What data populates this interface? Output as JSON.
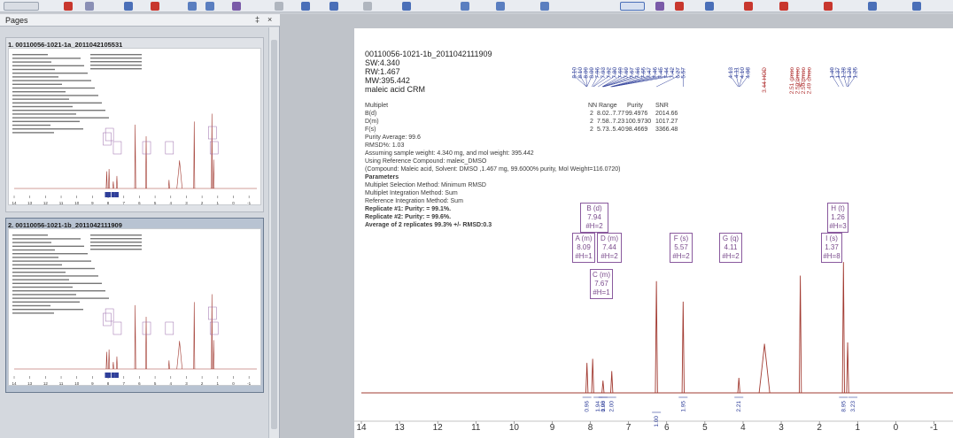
{
  "pages_panel": {
    "title": "Pages",
    "pin_label": "‡",
    "close_label": "×",
    "items": [
      {
        "index": "1.",
        "name": "00110056-1021-1a_2011042105531"
      },
      {
        "index": "2.",
        "name": "00110056-1021-1b_2011042111909"
      }
    ]
  },
  "report": {
    "sample_name": "00110056-1021-1b_2011042111909",
    "sw": "SW:4.340",
    "rw": "RW:1.467",
    "mw": "MW:395.442",
    "compound": "maleic acid CRM",
    "multiplet_label": "Multiplet",
    "table_header": [
      "NN",
      "Range",
      "Purity",
      "SNR"
    ],
    "table_rows": [
      {
        "name": "B(d)",
        "nn": "2",
        "range": "8.02..7.77",
        "purity": "99.4976",
        "snr": "2014.66"
      },
      {
        "name": "D(m)",
        "nn": "2",
        "range": "7.58..7.23",
        "purity": "100.9730",
        "snr": "1017.27"
      },
      {
        "name": "F(s)",
        "nn": "2",
        "range": "5.73..5.40",
        "purity": "98.4669",
        "snr": "3366.48"
      }
    ],
    "purity_average": "Purity Average: 99.6",
    "rmsd": "RMSD%: 1.03",
    "assuming": "Assuming sample weight: 4.340 mg, and mol weight: 395.442",
    "using_ref": "Using Reference Compound: maleic_DMSO",
    "compound_line": "(Compound: Maleic acid, Solvent: DMSO ,1.467 mg, 99.6000% purity, Mol Weight=116.0720)",
    "parameters_label": "Parameters",
    "param_1": "Multiplet Selection Method: Minimum RMSD",
    "param_2": "Multiplet Integration Method: Sum",
    "param_3": "Reference Integration Method: Sum",
    "replicate_1": "Replicate #1: Purity: = 99.1%.",
    "replicate_2": "Replicate #2: Purity: = 99.6%.",
    "average": "Average of 2 replicates 99.3% +/- RMSD:0.3"
  },
  "multiplets": [
    {
      "id": "A",
      "line1": "A (m)",
      "line2": "8.09",
      "line3": "#H=1"
    },
    {
      "id": "B",
      "line1": "B (d)",
      "line2": "7.94",
      "line3": "#H=2"
    },
    {
      "id": "C",
      "line1": "C (m)",
      "line2": "7.67",
      "line3": "#H=1"
    },
    {
      "id": "D",
      "line1": "D (m)",
      "line2": "7.44",
      "line3": "#H=2"
    },
    {
      "id": "F",
      "line1": "F (s)",
      "line2": "5.57",
      "line3": "#H=2"
    },
    {
      "id": "G",
      "line1": "G (q)",
      "line2": "4.11",
      "line3": "#H=2"
    },
    {
      "id": "H",
      "line1": "H (t)",
      "line2": "1.26",
      "line3": "#H=3"
    },
    {
      "id": "I",
      "line1": "I (s)",
      "line2": "1.37",
      "line3": "#H=8"
    }
  ],
  "peak_labels": {
    "aromatic": [
      "8.10",
      "8.10",
      "8.09",
      "8.09",
      "7.96",
      "7.93",
      "7.92",
      "7.80",
      "7.69",
      "7.69",
      "7.67",
      "7.66",
      "7.65",
      "7.47",
      "7.46",
      "7.45",
      "7.44",
      "7.42",
      "6.27"
    ],
    "singlet": [
      "5.57"
    ],
    "quartet": [
      "4.13",
      "4.11",
      "4.10",
      "4.08"
    ],
    "water": [
      "3.44 HOD"
    ],
    "dmso": [
      "2.51 dmso",
      "2.50 dmso",
      "2.50 dmso",
      "2.49 dmso"
    ],
    "aliphatic": [
      "1.49",
      "1.37",
      "1.28",
      "1.26",
      "1.25"
    ]
  },
  "integrals": [
    "0.96",
    "1.94",
    "1.00",
    "0.98",
    "2.00",
    "1.00",
    "1.95",
    "2.21",
    "8.95",
    "3.23"
  ],
  "chart_data": {
    "type": "line",
    "title": "",
    "xlabel": "",
    "ylabel": "",
    "x_reversed": true,
    "xlim": [
      14,
      -1.5
    ],
    "ylim": [
      0,
      1
    ],
    "x_ticks": [
      "14",
      "13",
      "12",
      "11",
      "10",
      "9",
      "8",
      "7",
      "6",
      "5",
      "4",
      "3",
      "2",
      "1",
      "0",
      "-1"
    ],
    "series": [
      {
        "peaks": [
          {
            "ppm": 8.09,
            "height": 0.22
          },
          {
            "ppm": 7.94,
            "height": 0.25
          },
          {
            "ppm": 7.67,
            "height": 0.09
          },
          {
            "ppm": 7.44,
            "height": 0.16
          },
          {
            "ppm": 6.27,
            "height": 0.82
          },
          {
            "ppm": 5.57,
            "height": 0.67
          },
          {
            "ppm": 4.11,
            "height": 0.11
          },
          {
            "ppm": 3.44,
            "height": 0.36
          },
          {
            "ppm": 2.5,
            "height": 0.86
          },
          {
            "ppm": 1.37,
            "height": 0.96
          },
          {
            "ppm": 1.26,
            "height": 0.37
          }
        ]
      }
    ],
    "color": "#a23b32"
  }
}
